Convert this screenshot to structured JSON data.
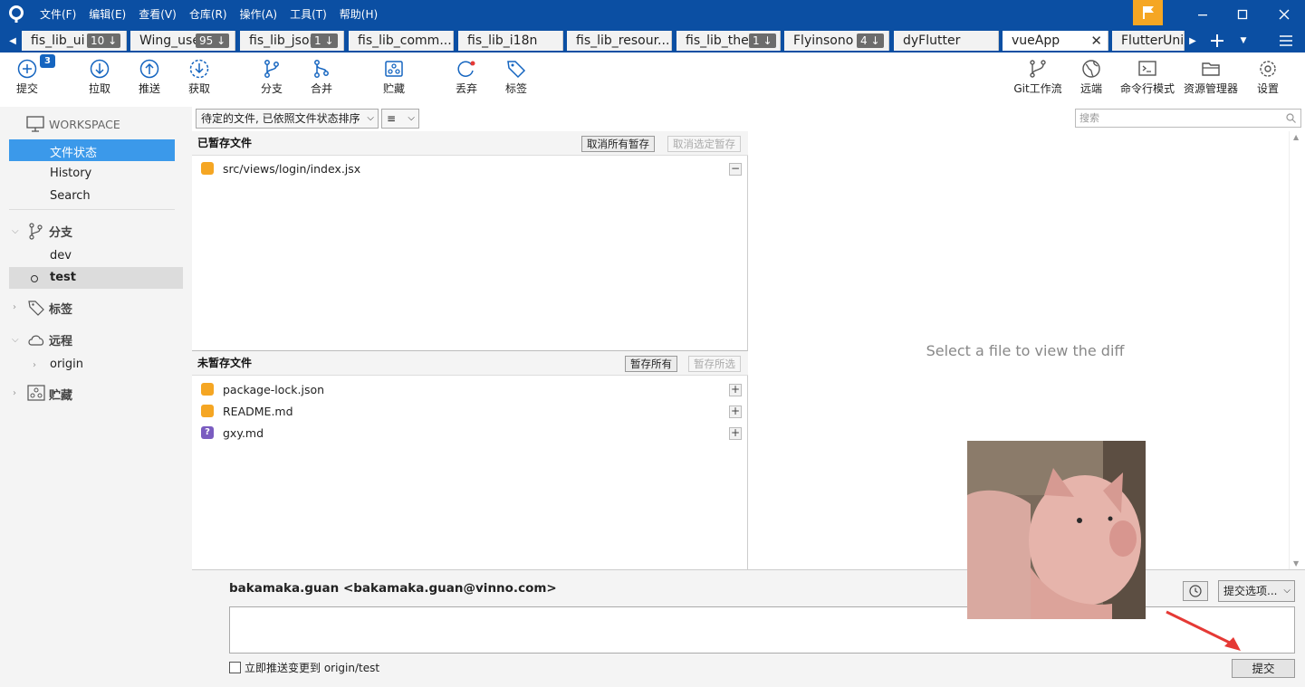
{
  "titlebar": {
    "menus": [
      "文件(F)",
      "编辑(E)",
      "查看(V)",
      "仓库(R)",
      "操作(A)",
      "工具(T)",
      "帮助(H)"
    ]
  },
  "tabs": [
    {
      "label": "fis_lib_ui",
      "badge": "10 ↓"
    },
    {
      "label": "Wing_use",
      "badge": "95 ↓"
    },
    {
      "label": "fis_lib_json",
      "badge": "1 ↓"
    },
    {
      "label": "fis_lib_comm...",
      "badge": ""
    },
    {
      "label": "fis_lib_i18n",
      "badge": ""
    },
    {
      "label": "fis_lib_resour...",
      "badge": ""
    },
    {
      "label": "fis_lib_ther",
      "badge": "1 ↓"
    },
    {
      "label": "Flyinsono",
      "badge": "4 ↓"
    },
    {
      "label": "dyFlutter",
      "badge": ""
    },
    {
      "label": "vueApp",
      "badge": "",
      "active": true
    },
    {
      "label": "FlutterUnit",
      "badge": ""
    }
  ],
  "toolbar": {
    "commit": "提交",
    "commit_count": "3",
    "pull": "拉取",
    "push": "推送",
    "fetch": "获取",
    "branch": "分支",
    "merge": "合并",
    "stash": "贮藏",
    "discard": "丢弃",
    "tag": "标签",
    "gitflow": "Git工作流",
    "remote": "远端",
    "terminal": "命令行模式",
    "explorer": "资源管理器",
    "settings": "设置"
  },
  "sidebar": {
    "workspace": "WORKSPACE",
    "file_status": "文件状态",
    "history": "History",
    "search": "Search",
    "branches": "分支",
    "branch_items": [
      "dev",
      "test"
    ],
    "tags": "标签",
    "remotes": "远程",
    "remote_items": [
      "origin"
    ],
    "stashes": "贮藏"
  },
  "filter": {
    "sort_label": "待定的文件, 已依照文件状态排序",
    "view_label": "≡",
    "search_placeholder": "搜索"
  },
  "staged": {
    "title": "已暂存文件",
    "unstage_all": "取消所有暂存",
    "unstage_selected": "取消选定暂存",
    "files": [
      {
        "name": "src/views/login/index.jsx",
        "status": "modified"
      }
    ]
  },
  "unstaged": {
    "title": "未暂存文件",
    "stage_all": "暂存所有",
    "stage_selected": "暂存所选",
    "files": [
      {
        "name": "package-lock.json",
        "status": "modified"
      },
      {
        "name": "README.md",
        "status": "modified"
      },
      {
        "name": "gxy.md",
        "status": "untracked"
      }
    ]
  },
  "diff": {
    "placeholder": "Select a file to view the diff"
  },
  "commit": {
    "author": "bakamaka.guan <bakamaka.guan@vinno.com>",
    "message": "",
    "options": "提交选项...",
    "push_immediately": "立即推送变更到 origin/test",
    "submit": "提交"
  },
  "colors": {
    "accent": "#0b4fa3",
    "selection": "#3b99ea",
    "modified": "#f5a623",
    "untracked": "#7a5cc0"
  }
}
